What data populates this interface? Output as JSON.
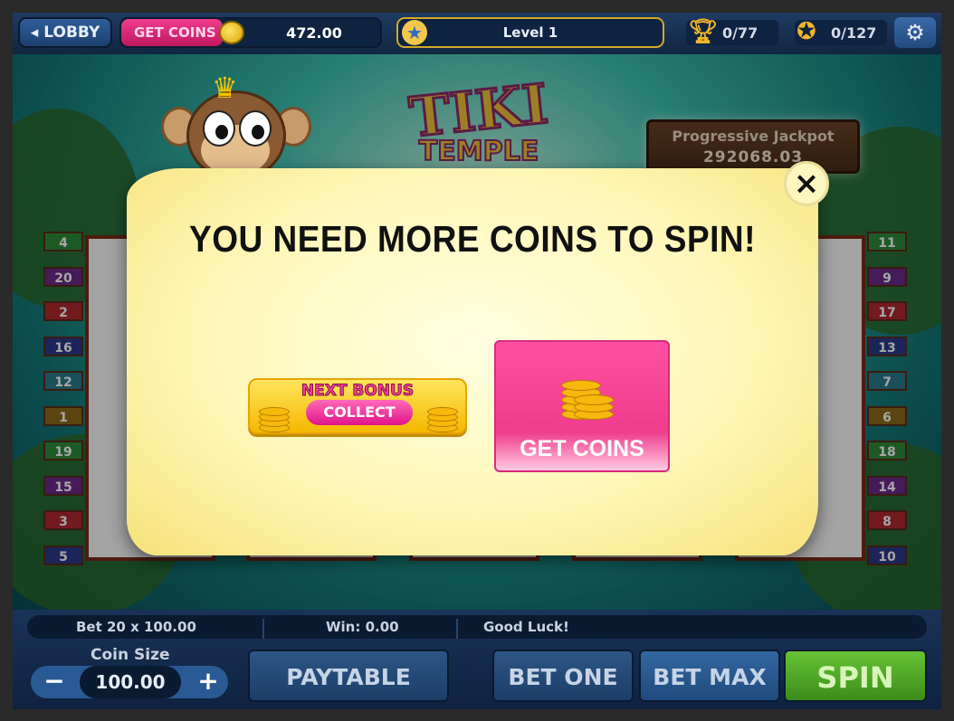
{
  "topbar": {
    "lobby_label": "LOBBY",
    "get_coins_label": "GET COINS",
    "coin_balance": "472.00",
    "level_label": "Level 1",
    "trophies": "0/77",
    "achievements": "0/127"
  },
  "game": {
    "logo_line1": "TIKI",
    "logo_line2": "TEMPLE",
    "jackpot_title": "Progressive Jackpot",
    "jackpot_value": "292068.03",
    "left_paylines": [
      "4",
      "20",
      "2",
      "16",
      "12",
      "1",
      "19",
      "15",
      "3",
      "5"
    ],
    "right_paylines": [
      "11",
      "9",
      "17",
      "13",
      "7",
      "6",
      "18",
      "14",
      "8",
      "10"
    ]
  },
  "modal": {
    "title": "YOU NEED MORE COINS TO SPIN!",
    "close_label": "×",
    "bonus_top": "NEXT BONUS",
    "bonus_collect": "COLLECT",
    "get_coins_label": "GET COINS"
  },
  "bottom": {
    "bet_info": "Bet 20 x 100.00",
    "win_info": "Win: 0.00",
    "status": "Good Luck!",
    "coin_size_label": "Coin Size",
    "coin_size_value": "100.00",
    "minus": "−",
    "plus": "+",
    "paytable": "PAYTABLE",
    "bet_one": "BET ONE",
    "bet_max": "BET MAX",
    "spin": "SPIN"
  },
  "colors": {
    "payline_palette": [
      "#2f8a3a",
      "#6a2a8a",
      "#b0282e",
      "#2a3a8a",
      "#2a7a8a",
      "#8a6a1a"
    ]
  }
}
